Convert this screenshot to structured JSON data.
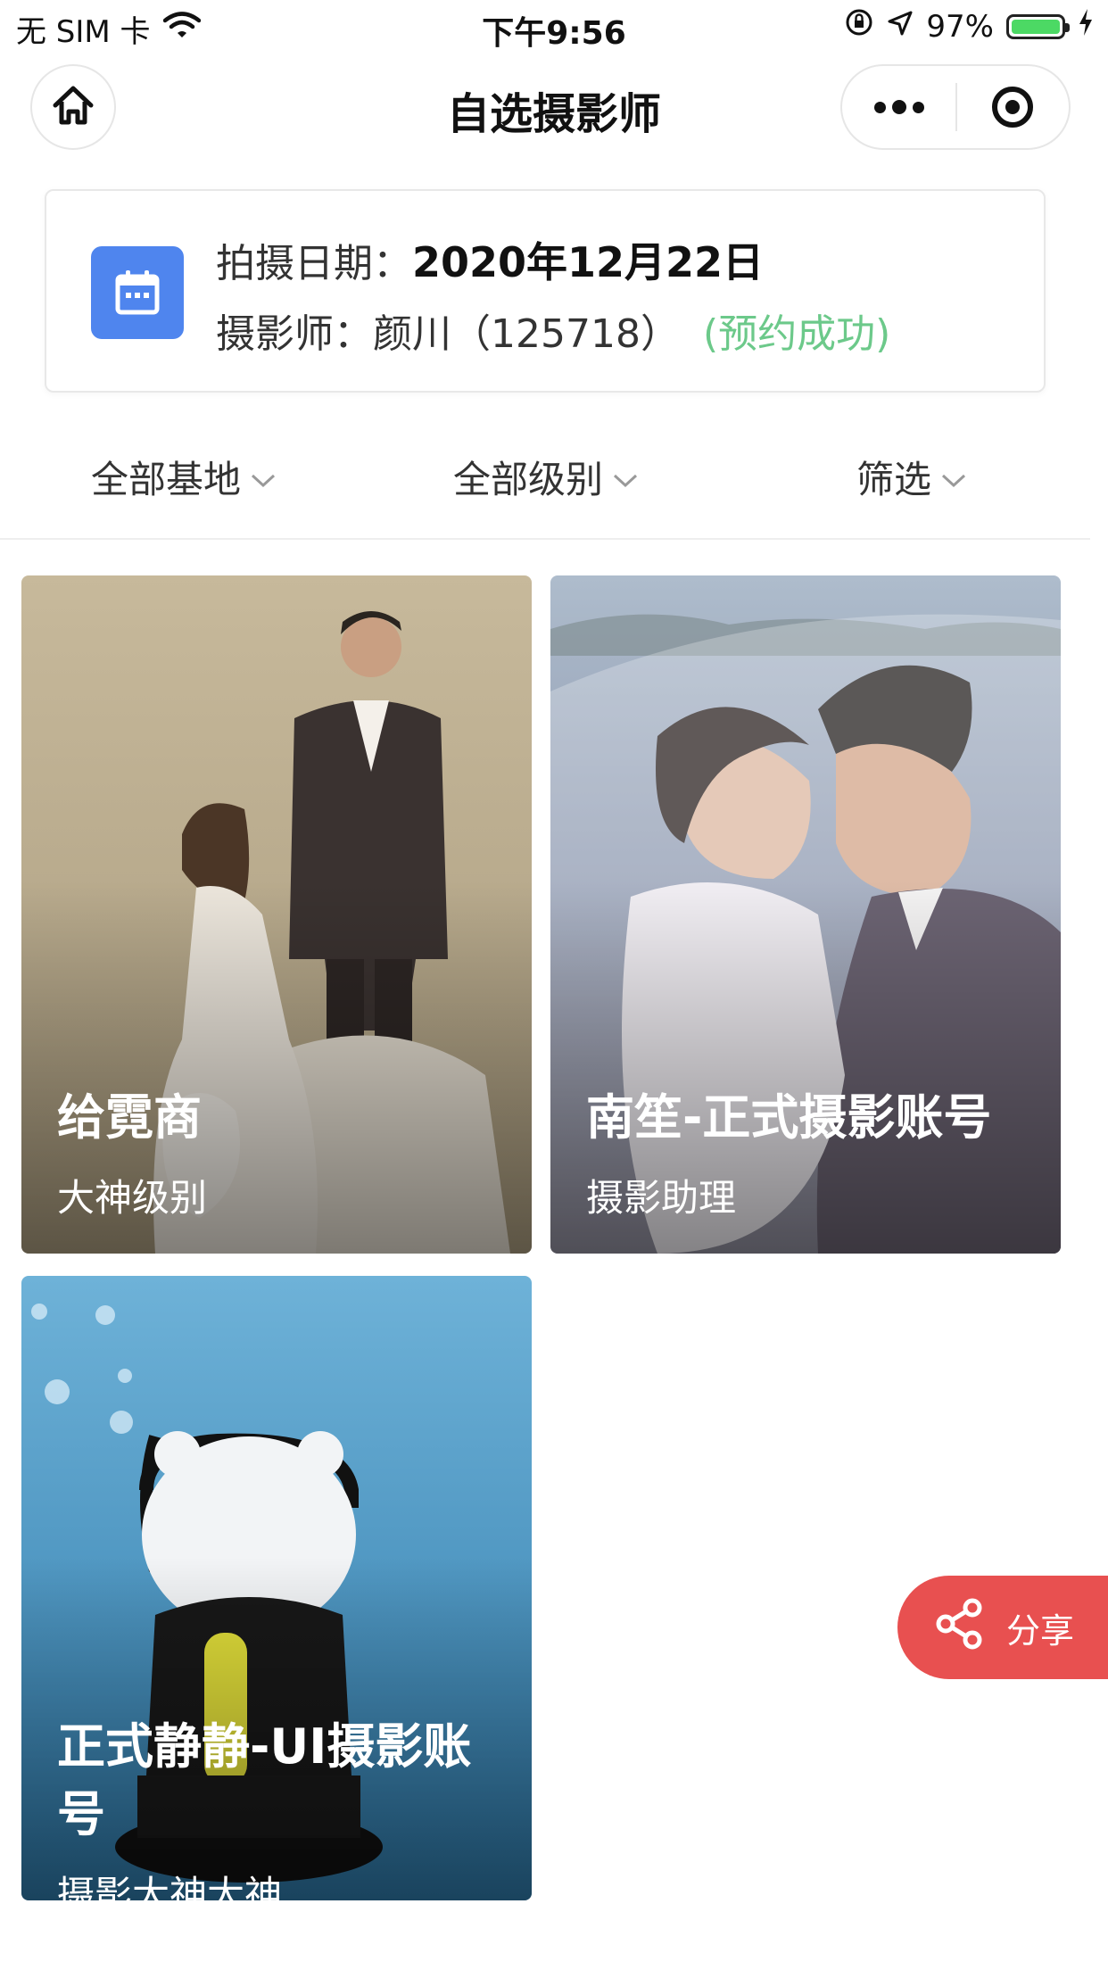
{
  "status_bar": {
    "carrier": "无 SIM 卡",
    "time": "下午9:56",
    "battery_percent": "97%",
    "battery_level": 0.97,
    "battery_color": "#4cd964"
  },
  "nav": {
    "title": "自选摄影师",
    "home_icon": "home-icon",
    "more_icon": "more-icon",
    "close_icon": "target-icon"
  },
  "booking": {
    "date_label": "拍摄日期：",
    "date_value": "2020年12月22日",
    "photographer_label": "摄影师：",
    "photographer_value": "颜川（125718）",
    "status": "(预约成功)",
    "icon": "calendar-icon",
    "accent_color": "#4f85ee",
    "status_color": "#6cc98a"
  },
  "filters": [
    {
      "label": "全部基地"
    },
    {
      "label": "全部级别"
    },
    {
      "label": "筛选"
    }
  ],
  "cards": [
    {
      "name": "给霓商",
      "level": "大神级别"
    },
    {
      "name": "南笙-正式摄影账号",
      "level": "摄影助理"
    },
    {
      "name": "正式静静-UI摄影账号",
      "level": "摄影大神大神"
    }
  ],
  "share": {
    "label": "分享",
    "icon": "share-icon",
    "color": "#e85050"
  }
}
